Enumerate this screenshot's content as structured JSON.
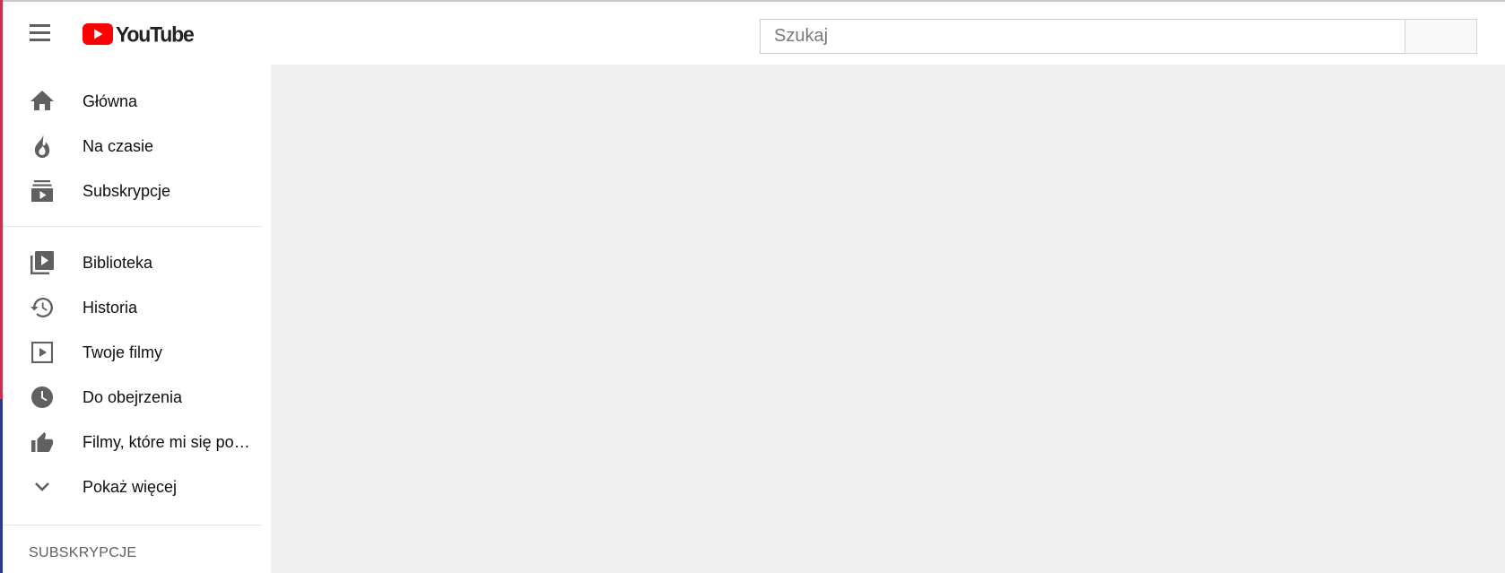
{
  "header": {
    "logo_text": "YouTube",
    "search": {
      "placeholder": "Szukaj",
      "value": ""
    }
  },
  "sidebar": {
    "items": [
      {
        "label": "Główna",
        "icon": "home-icon"
      },
      {
        "label": "Na czasie",
        "icon": "trending-icon"
      },
      {
        "label": "Subskrypcje",
        "icon": "subscriptions-icon"
      }
    ],
    "library_items": [
      {
        "label": "Biblioteka",
        "icon": "library-icon"
      },
      {
        "label": "Historia",
        "icon": "history-icon"
      },
      {
        "label": "Twoje filmy",
        "icon": "your-videos-icon"
      },
      {
        "label": "Do obejrzenia",
        "icon": "watch-later-icon"
      },
      {
        "label": "Filmy, które mi się po…",
        "icon": "thumbs-up-icon"
      },
      {
        "label": "Pokaż więcej",
        "icon": "chevron-down-icon"
      }
    ],
    "subscriptions_title": "SUBSKRYPCJE"
  },
  "colors": {
    "brand_red": "#ff0000",
    "icon_gray": "#606060",
    "content_bg": "#f0f0f0"
  }
}
